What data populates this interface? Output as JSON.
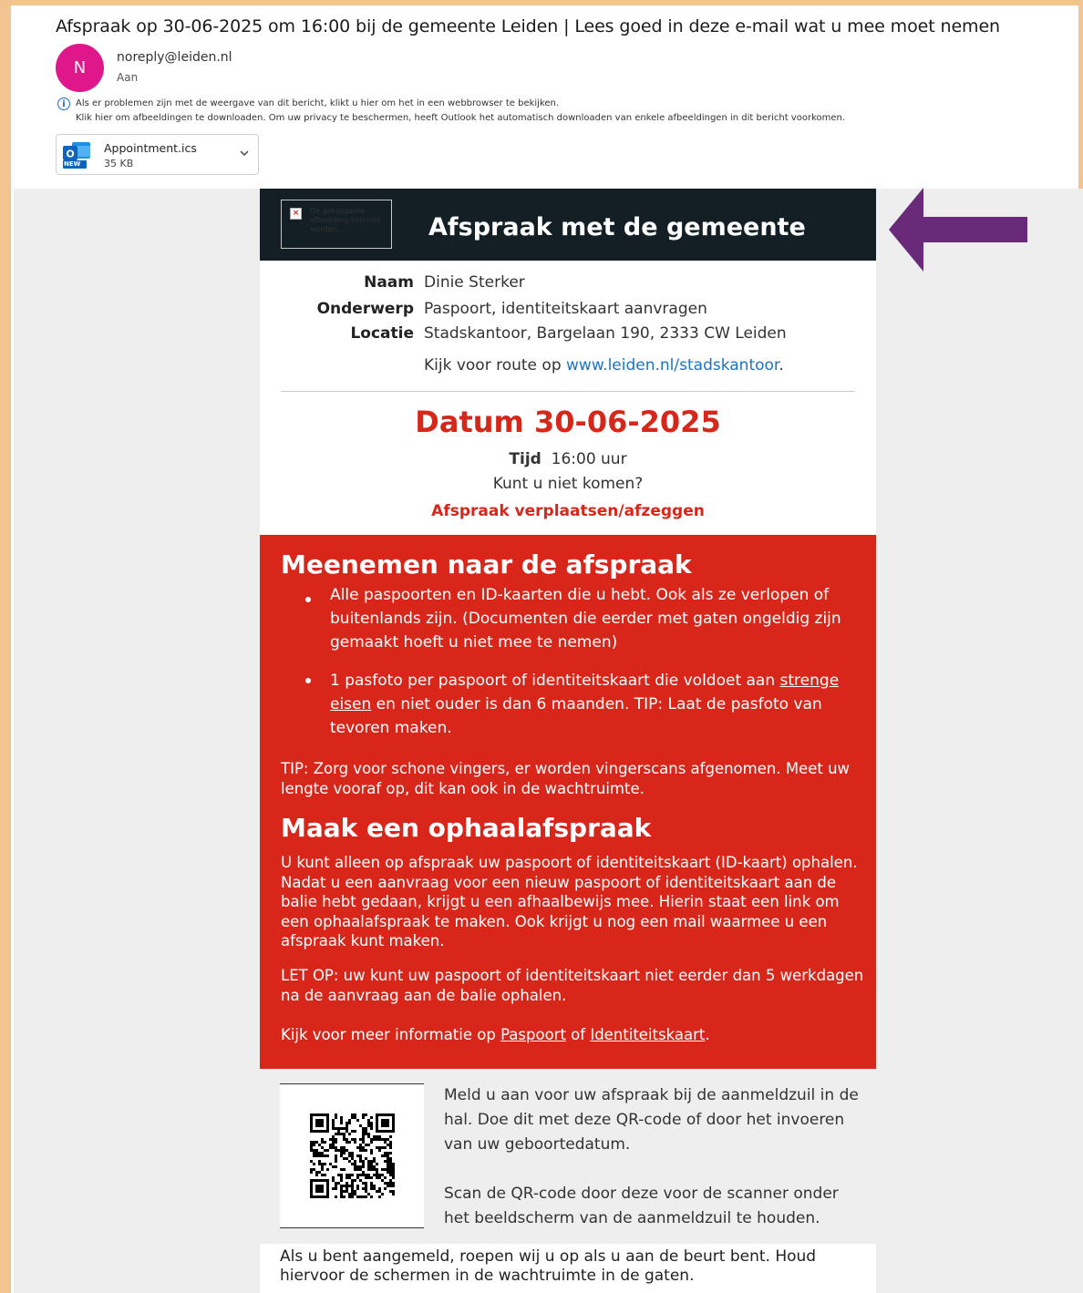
{
  "email": {
    "subject": "Afspraak op 30-06-2025 om 16:00 bij de gemeente Leiden | Lees goed in deze e-mail wat u mee moet nemen",
    "avatar_initial": "N",
    "sender": "noreply@leiden.nl",
    "to_label": "Aan",
    "notice_line1": "Als er problemen zijn met de weergave van dit bericht, klikt u hier om het in een webbrowser te bekijken.",
    "notice_line2": "Klik hier om afbeeldingen te downloaden. Om uw privacy te beschermen, heeft Outlook het automatisch downloaden van enkele afbeeldingen in dit bericht voorkomen.",
    "attachment": {
      "name": "Appointment.ics",
      "size": "35 KB",
      "badge": "NEW",
      "icon": "outlook-icon"
    }
  },
  "body": {
    "broken_image_text": "De gekoppelde afbeelding kan niet worden...",
    "header_title": "Afspraak met de gemeente",
    "details": {
      "naam_label": "Naam",
      "naam_value": "Dinie Sterker",
      "onderwerp_label": "Onderwerp",
      "onderwerp_value": "Paspoort, identiteitskaart aanvragen",
      "locatie_label": "Locatie",
      "locatie_value": "Stadskantoor, Bargelaan 190, 2333 CW Leiden",
      "route_prefix": "Kijk voor route op ",
      "route_link": "www.leiden.nl/stadskantoor",
      "route_suffix": "."
    },
    "datum": "Datum 30-06-2025",
    "tijd_label": "Tijd",
    "tijd_value": "16:00 uur",
    "kunt_niet": "Kunt u niet komen?",
    "verplaatsen_link": "Afspraak verplaatsen/afzeggen",
    "meenemen": {
      "title": "Meenemen naar de afspraak",
      "bullet1": "Alle paspoorten en ID-kaarten die u hebt. Ook als ze verlopen of bui­tenlands zijn. (Documenten die eerder met gaten ongeldig zijn gemaakt hoeft u niet mee te nemen)",
      "bullet2_prefix": "1 pasfoto per paspoort of identiteitskaart die voldoet aan ",
      "bullet2_link": "strenge eisen",
      "bullet2_suffix": " en niet ouder is dan 6 maanden. TIP: Laat de pasfoto van tevoren maken.",
      "tip": "TIP: Zorg voor schone vingers, er worden vingerscans afgenomen. Meet uw lengte vooraf op, dit kan ook in de wachtruimte."
    },
    "ophaal": {
      "title": "Maak een ophaalafspraak",
      "para1": "U kunt alleen op afspraak uw paspoort of identiteitskaart (ID-kaart) ophalen. Nadat u een aanvraag voor een nieuw paspoort of identiteitskaart aan de balie hebt gedaan, krijgt u een afhaalbewijs mee. Hierin staat een link om een ophaalafspraak te maken. Ook krijgt u nog een mail waarmee u een afspraak kunt maken.",
      "para2": "LET OP: uw kunt uw paspoort of identiteitskaart niet eerder dan 5 werkdagen na de aanvraag aan de balie ophalen.",
      "para3_prefix": "Kijk voor meer informatie op ",
      "link_paspoort": "Paspoort",
      "para3_mid": " of ",
      "link_id": "Identiteitskaart",
      "para3_suffix": "."
    },
    "meld": "Meld u aan voor uw afspraak bij de aanmeldzuil in de hal. Doe dit met deze QR-code of door het invoeren van uw geboortedatum.",
    "scan": "Scan de QR-code door deze voor de scanner onder het beeldscherm van de aanmeldzuil te houden.",
    "bottom": "Als u bent aangemeld, roepen wij u op als u aan de beurt bent. Houd hiervoor de schermen in de wachtruimte in de gaten."
  },
  "colors": {
    "accent_red": "#d8261a",
    "header_dark": "#131f24",
    "arrow_purple": "#6a2a7a",
    "link_blue": "#1b73c8",
    "avatar_pink": "#e0168b"
  }
}
